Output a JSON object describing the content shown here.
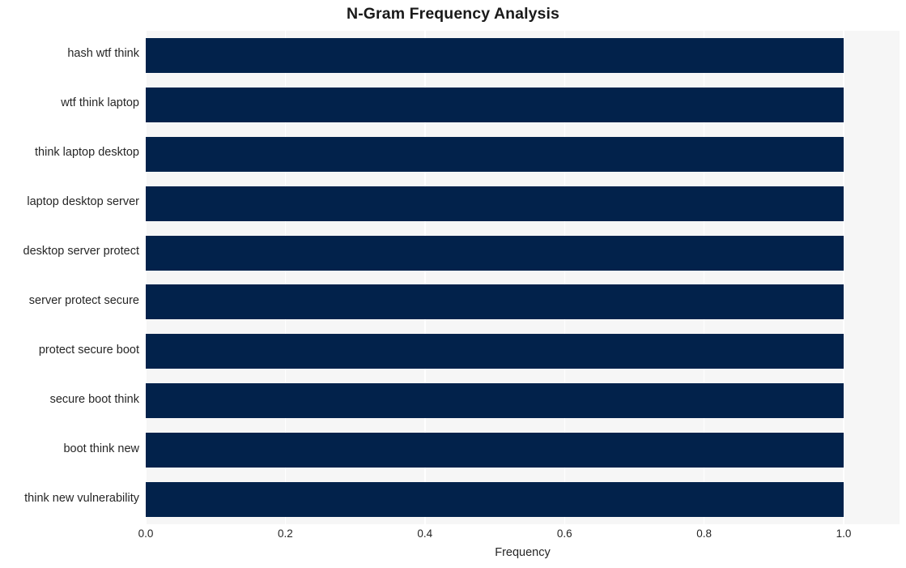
{
  "chart_data": {
    "type": "bar",
    "orientation": "horizontal",
    "title": "N-Gram Frequency Analysis",
    "xlabel": "Frequency",
    "ylabel": "",
    "categories": [
      "hash wtf think",
      "wtf think laptop",
      "think laptop desktop",
      "laptop desktop server",
      "desktop server protect",
      "server protect secure",
      "protect secure boot",
      "secure boot think",
      "boot think new",
      "think new vulnerability"
    ],
    "values": [
      1.0,
      1.0,
      1.0,
      1.0,
      1.0,
      1.0,
      1.0,
      1.0,
      1.0,
      1.0
    ],
    "xlim": [
      0.0,
      1.08
    ],
    "ylim": [
      -0.5,
      9.5
    ],
    "xticks": [
      "0.0",
      "0.2",
      "0.4",
      "0.6",
      "0.8",
      "1.0"
    ],
    "xtick_values": [
      0.0,
      0.2,
      0.4,
      0.6,
      0.8,
      1.0
    ],
    "grid": true,
    "grid_axis": "x",
    "legend": false,
    "legend_position": "none",
    "bar_color": "#02224b",
    "plot_background": "#f6f6f6",
    "gridline_color": "#ffffff",
    "figure_background": "#ffffff",
    "text_color": "#262626",
    "title_color": "#1a1a1a"
  }
}
